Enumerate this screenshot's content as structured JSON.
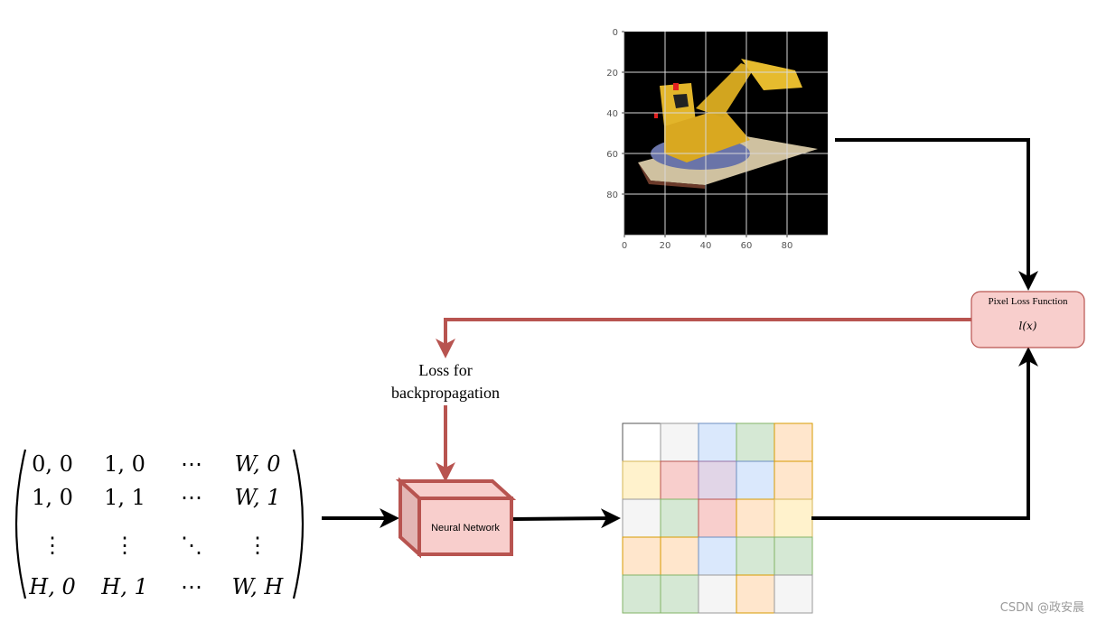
{
  "input_matrix": {
    "rows": [
      [
        "0, 0",
        "1, 0",
        "⋯",
        "W, 0"
      ],
      [
        "1, 0",
        "1, 1",
        "⋯",
        "W, 1"
      ],
      [
        "⋮",
        "⋮",
        "⋱",
        "⋮"
      ],
      [
        "H, 0",
        "H, 1",
        "⋯",
        "W, H"
      ]
    ]
  },
  "neural_network": {
    "label": "Neural Network"
  },
  "loss_label": {
    "line1": "Loss for",
    "line2": "backpropagation"
  },
  "loss_function": {
    "title": "Pixel Loss Function",
    "formula": "l(x)"
  },
  "target_image": {
    "description": "Rendered LEGO bulldozer on black background",
    "x_ticks": [
      "0",
      "20",
      "40",
      "60",
      "80"
    ],
    "y_ticks": [
      "0",
      "20",
      "40",
      "60",
      "80"
    ]
  },
  "output_grid": {
    "rows": 5,
    "cols": 5,
    "cells": [
      [
        "white",
        "gray",
        "blue",
        "green",
        "orange"
      ],
      [
        "yellow",
        "red",
        "purple",
        "blue",
        "orange"
      ],
      [
        "gray",
        "green",
        "red",
        "orange",
        "yellow"
      ],
      [
        "orange",
        "orange",
        "blue",
        "green",
        "green"
      ],
      [
        "green",
        "green",
        "gray",
        "orange",
        "gray"
      ]
    ]
  },
  "palette": {
    "white": {
      "fill": "#ffffff",
      "stroke": "#555555"
    },
    "gray": {
      "fill": "#f5f5f5",
      "stroke": "#999999"
    },
    "blue": {
      "fill": "#dae8fc",
      "stroke": "#6c8ebf"
    },
    "green": {
      "fill": "#d5e8d4",
      "stroke": "#82b366"
    },
    "orange": {
      "fill": "#ffe6cc",
      "stroke": "#d79b00"
    },
    "yellow": {
      "fill": "#fff2cc",
      "stroke": "#d6b656"
    },
    "red": {
      "fill": "#f8cecc",
      "stroke": "#b85450"
    },
    "purple": {
      "fill": "#e1d5e7",
      "stroke": "#9673a6"
    }
  },
  "colors": {
    "loss_arrow": "#b85450",
    "main_arrow": "#000000",
    "nn_fill": "#f8cecc",
    "nn_stroke": "#b85450"
  },
  "watermark": "CSDN @政安晨"
}
